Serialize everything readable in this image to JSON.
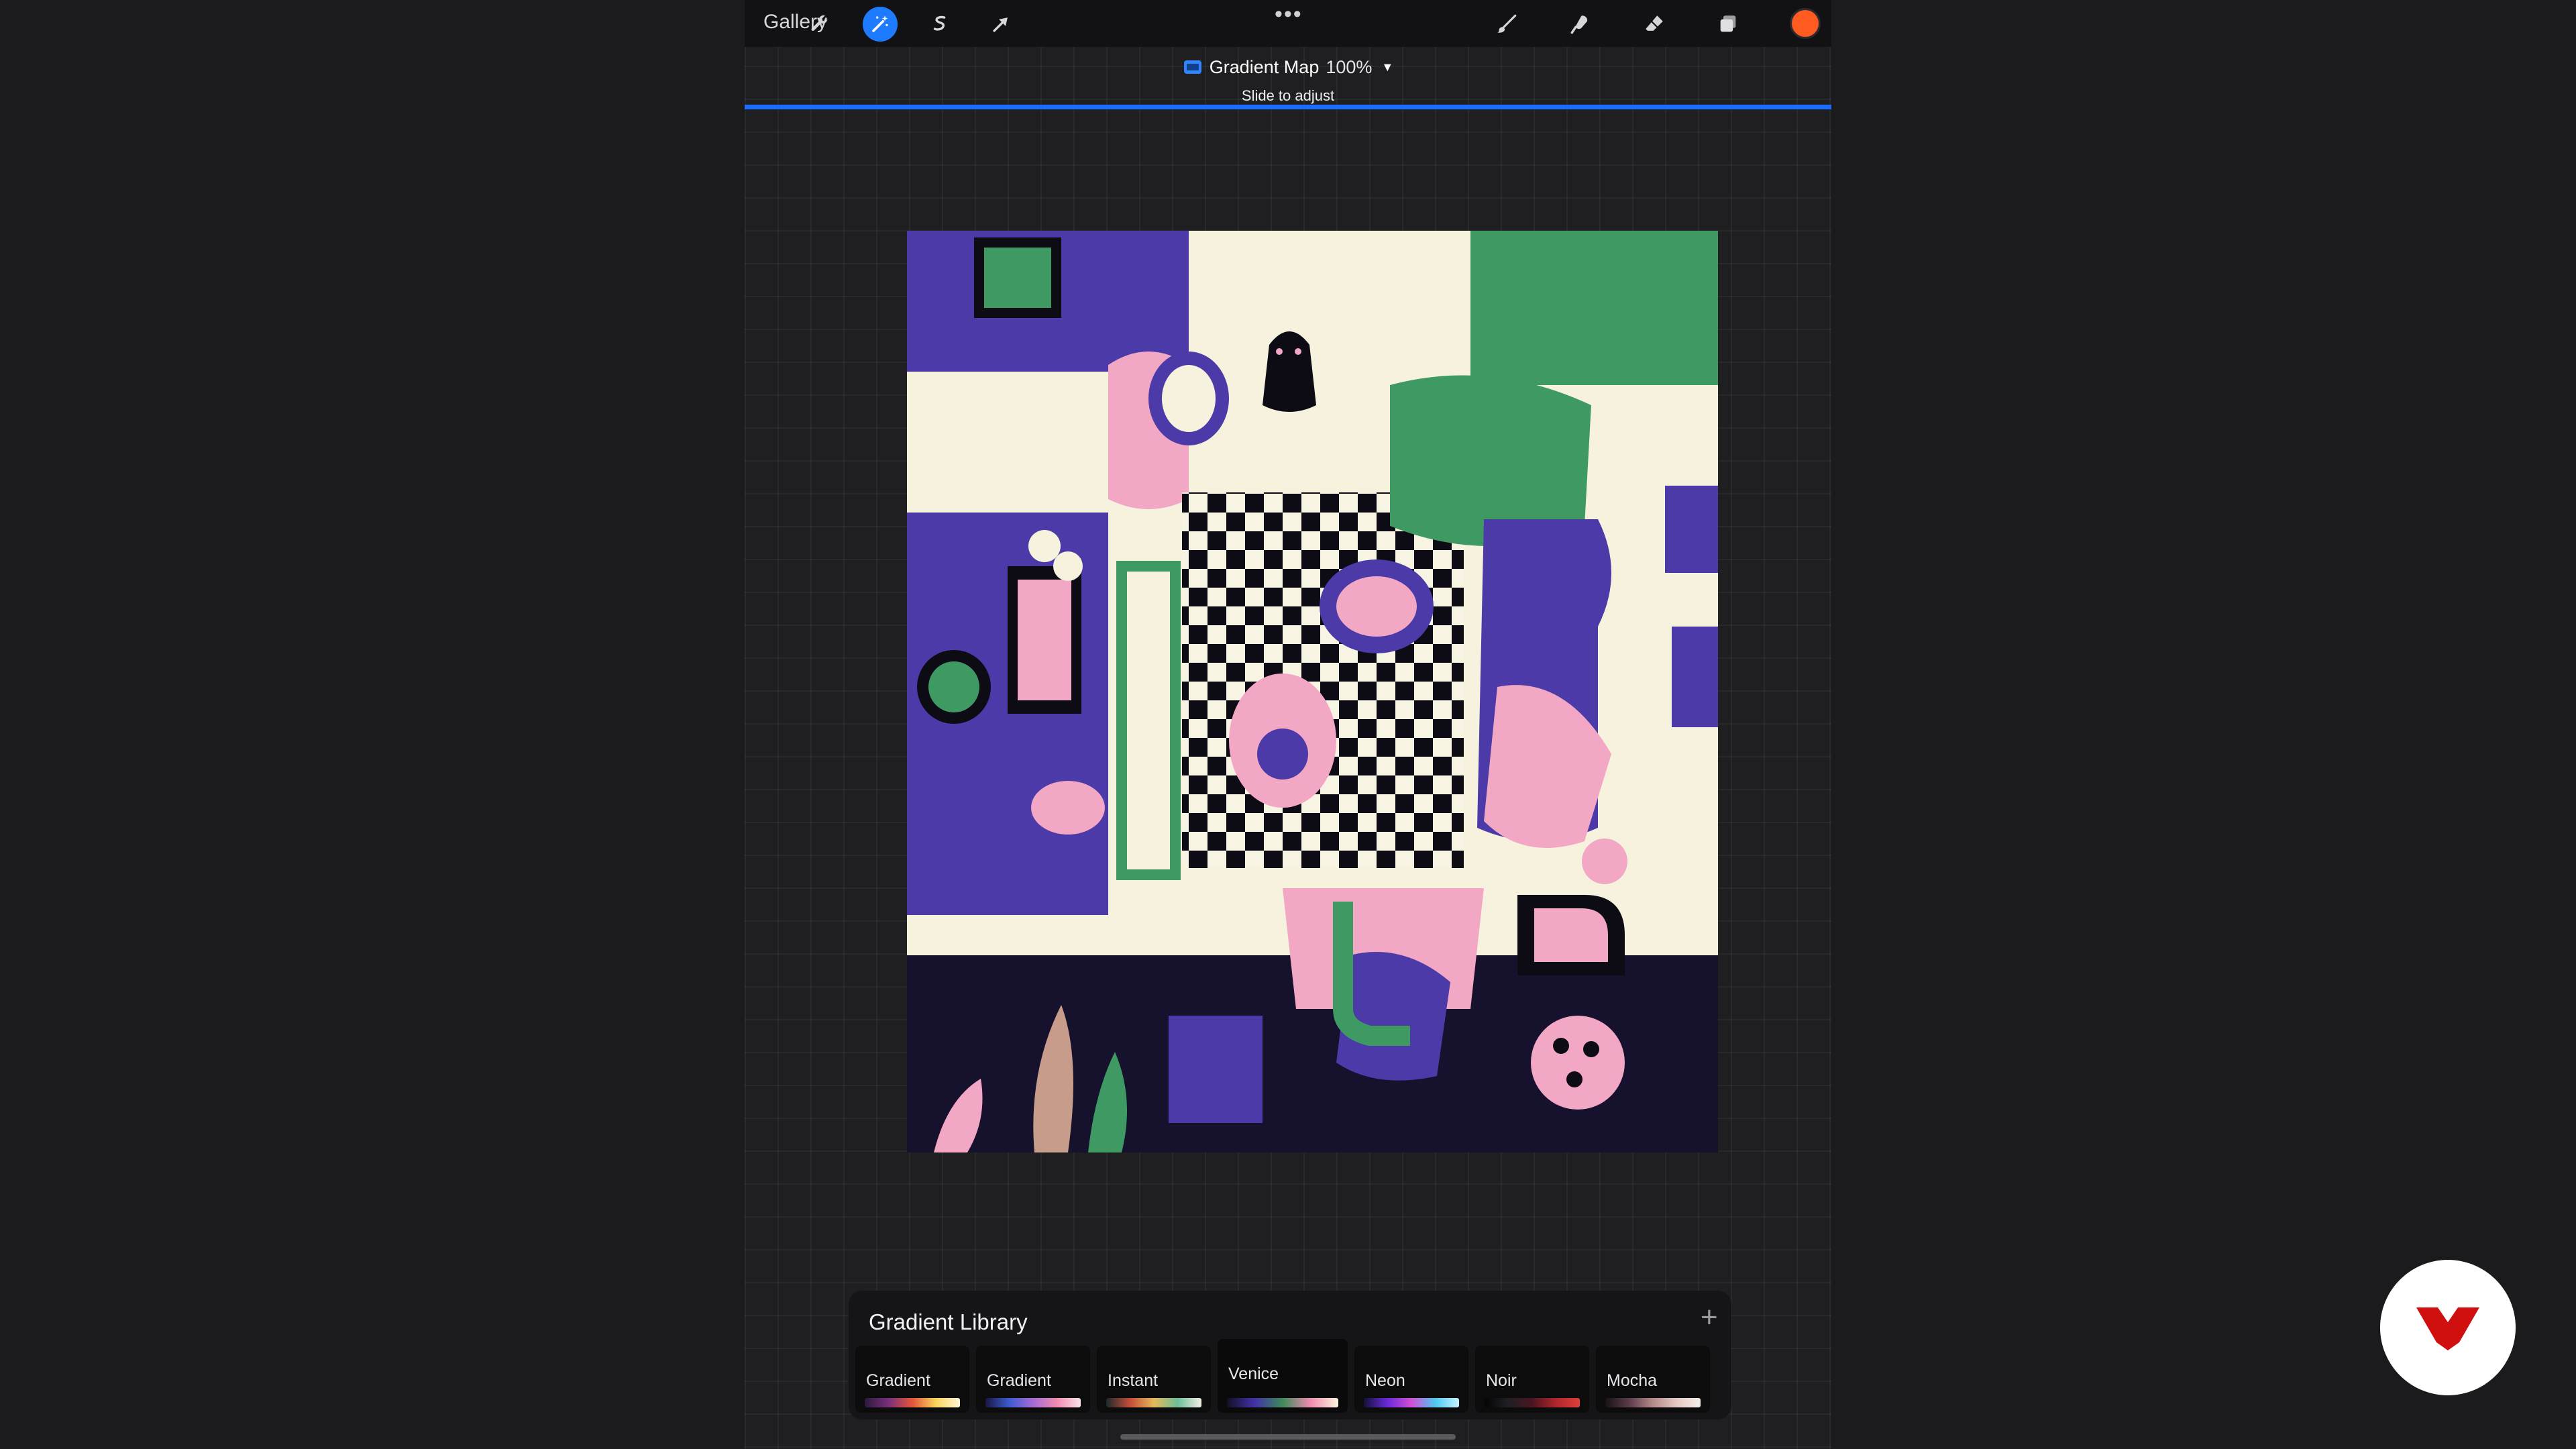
{
  "toolbar": {
    "gallery_label": "Gallery",
    "left_icons": [
      "wrench-icon",
      "magic-wand-icon",
      "selection-icon",
      "transform-arrow-icon"
    ],
    "right_icons": [
      "brush-icon",
      "smudge-icon",
      "eraser-icon",
      "layers-icon"
    ],
    "active_icon": "magic-wand-icon",
    "more_label": "•••",
    "current_color": "#ff5a1f"
  },
  "adjustment": {
    "name": "Gradient Map",
    "percent": "100%",
    "hint": "Slide to adjust",
    "slider_value": 1.0,
    "slider_color": "#1a6dff"
  },
  "library": {
    "title": "Gradient Library",
    "add_label": "+",
    "selected": "Venice",
    "gradients": [
      {
        "name": "Gradient",
        "colors": [
          "#2a1a3d",
          "#7a2f7a",
          "#e3553a",
          "#f8d55e",
          "#fff6d4"
        ]
      },
      {
        "name": "Gradient",
        "colors": [
          "#1a1640",
          "#3d5bd1",
          "#a66bd6",
          "#f08bb0",
          "#fbe4ea"
        ]
      },
      {
        "name": "Instant",
        "colors": [
          "#1a2a2a",
          "#c64d3a",
          "#e6b85a",
          "#6dbf9a",
          "#f3efe5"
        ]
      },
      {
        "name": "Venice",
        "colors": [
          "#111024",
          "#4133a8",
          "#3e8a5a",
          "#f08bb0",
          "#fbf6dc"
        ]
      },
      {
        "name": "Neon",
        "colors": [
          "#14103a",
          "#6a2ad8",
          "#d24fd6",
          "#4fc8f0",
          "#c5f4ff"
        ]
      },
      {
        "name": "Noir",
        "colors": [
          "#050505",
          "#1f1f25",
          "#4a1520",
          "#b0262c",
          "#e0403a"
        ]
      },
      {
        "name": "Mocha",
        "colors": [
          "#1a1216",
          "#5a3b4a",
          "#b48a8a",
          "#e6c9c4",
          "#f6efe9"
        ]
      }
    ]
  }
}
